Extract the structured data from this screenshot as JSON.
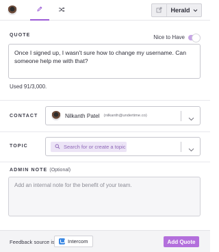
{
  "header": {
    "brand_label": "Herald",
    "icons": [
      "avatar",
      "pencil-icon",
      "shuffle-icon",
      "external-link-icon",
      "chevron-down-icon"
    ]
  },
  "quote": {
    "label": "QUOTE",
    "nice_to_have_label": "Nice to Have",
    "nice_to_have_on": true,
    "text": "Once I signed up, I wasn't sure how to change my username. Can someone help me with that?",
    "used": "Used 91/3,000."
  },
  "contact": {
    "label": "CONTACT",
    "name": "Nilkanth Patel",
    "email": "(nilkanth@undertime.co)"
  },
  "topic": {
    "label": "TOPIC",
    "placeholder": "Search for or create a topic"
  },
  "admin_note": {
    "label": "ADMIN NOTE",
    "optional": "(Optional)",
    "placeholder": "Add an internal note for the benefit of your team."
  },
  "footer": {
    "feedback_source_label": "Feedback source is",
    "source_name": "Intercom",
    "add_button": "Add Quote"
  },
  "colors": {
    "accent": "#b36fdc",
    "topic_pill_bg": "#ece4f6",
    "intercom_blue": "#3b88e3"
  }
}
